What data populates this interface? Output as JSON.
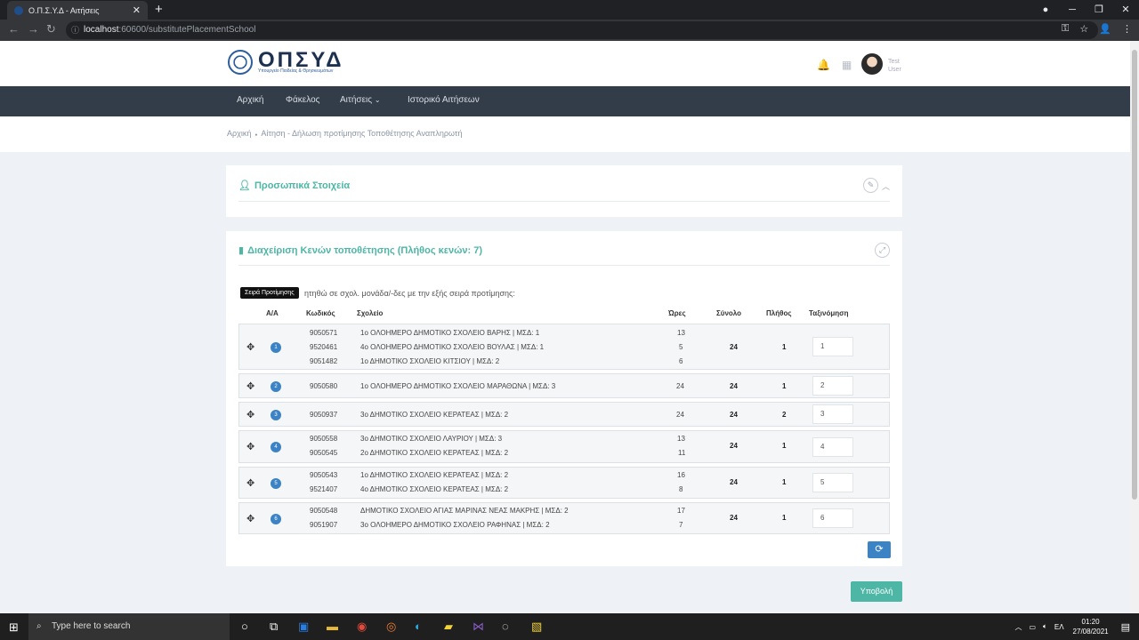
{
  "browser": {
    "tab_title": "Ο.Π.Σ.Υ.Δ - Αιτήσεις",
    "url_host": "localhost",
    "url_path": ":60600/substitutePlacementSchool"
  },
  "header": {
    "logo_title": "ΟΠΣΥΔ",
    "logo_subtitle": "Υπουργείο Παιδείας & Θρησκευμάτων",
    "user_line1": "Test",
    "user_line2": "User"
  },
  "nav": {
    "home": "Αρχική",
    "folder": "Φάκελος",
    "applications": "Αιτήσεις",
    "history": "Ιστορικό Αιτήσεων"
  },
  "breadcrumb": {
    "home": "Αρχική",
    "sep": "●",
    "current": "Αίτηση - Δήλωση προτίμησης Τοποθέτησης Αναπληρωτή"
  },
  "personal_panel": {
    "title": "Προσωπικά Στοιχεία"
  },
  "vacancies_panel": {
    "title": "Διαχείριση Κενών τοποθέτησης (Πλήθος κενών: 7)",
    "tooltip": "Σειρά Προτίμησης",
    "intro": "ητηθώ σε σχολ. μονάδα/-δες με την εξής σειρά προτίμησης:",
    "columns": {
      "aa": "Α/Α",
      "code": "Κωδικός",
      "school": "Σχολείο",
      "hours": "Ώρες",
      "total": "Σύνολο",
      "count": "Πλήθος",
      "ranking": "Ταξινόμηση"
    },
    "groups": [
      {
        "rank": "1",
        "total": "24",
        "count": "1",
        "order": "1",
        "rows": [
          {
            "code": "9050571",
            "school": "1ο ΟΛΟΗΜΕΡΟ ΔΗΜΟΤΙΚΟ ΣΧΟΛΕΙΟ ΒΑΡΗΣ | ΜΣΔ: 1",
            "hours": "13"
          },
          {
            "code": "9520461",
            "school": "4ο ΟΛΟΗΜΕΡΟ ΔΗΜΟΤΙΚΟ ΣΧΟΛΕΙΟ ΒΟΥΛΑΣ | ΜΣΔ: 1",
            "hours": "5"
          },
          {
            "code": "9051482",
            "school": "1ο ΔΗΜΟΤΙΚΟ ΣΧΟΛΕΙΟ ΚΙΤΣΙΟΥ | ΜΣΔ: 2",
            "hours": "6"
          }
        ]
      },
      {
        "rank": "2",
        "total": "24",
        "count": "1",
        "order": "2",
        "rows": [
          {
            "code": "9050580",
            "school": "1ο ΟΛΟΗΜΕΡΟ ΔΗΜΟΤΙΚΟ ΣΧΟΛΕΙΟ ΜΑΡΑΘΩΝΑ | ΜΣΔ: 3",
            "hours": "24"
          }
        ]
      },
      {
        "rank": "3",
        "total": "24",
        "count": "2",
        "order": "3",
        "rows": [
          {
            "code": "9050937",
            "school": "3ο ΔΗΜΟΤΙΚΟ ΣΧΟΛΕΙΟ ΚΕΡΑΤΕΑΣ | ΜΣΔ: 2",
            "hours": "24"
          }
        ]
      },
      {
        "rank": "4",
        "total": "24",
        "count": "1",
        "order": "4",
        "rows": [
          {
            "code": "9050558",
            "school": "3ο ΔΗΜΟΤΙΚΟ ΣΧΟΛΕΙΟ ΛΑΥΡΙΟΥ | ΜΣΔ: 3",
            "hours": "13"
          },
          {
            "code": "9050545",
            "school": "2ο ΔΗΜΟΤΙΚΟ ΣΧΟΛΕΙΟ ΚΕΡΑΤΕΑΣ | ΜΣΔ: 2",
            "hours": "11"
          }
        ]
      },
      {
        "rank": "5",
        "total": "24",
        "count": "1",
        "order": "5",
        "rows": [
          {
            "code": "9050543",
            "school": "1ο ΔΗΜΟΤΙΚΟ ΣΧΟΛΕΙΟ ΚΕΡΑΤΕΑΣ | ΜΣΔ: 2",
            "hours": "16"
          },
          {
            "code": "9521407",
            "school": "4ο ΔΗΜΟΤΙΚΟ ΣΧΟΛΕΙΟ ΚΕΡΑΤΕΑΣ | ΜΣΔ: 2",
            "hours": "8"
          }
        ]
      },
      {
        "rank": "6",
        "total": "24",
        "count": "1",
        "order": "6",
        "rows": [
          {
            "code": "9050548",
            "school": "ΔΗΜΟΤΙΚΟ ΣΧΟΛΕΙΟ ΑΓΙΑΣ ΜΑΡΙΝΑΣ ΝΕΑΣ ΜΑΚΡΗΣ | ΜΣΔ: 2",
            "hours": "17"
          },
          {
            "code": "9051907",
            "school": "3ο ΟΛΟΗΜΕΡΟ ΔΗΜΟΤΙΚΟ ΣΧΟΛΕΙΟ ΡΑΦΗΝΑΣ | ΜΣΔ: 2",
            "hours": "7"
          }
        ]
      }
    ]
  },
  "actions": {
    "submit": "Υποβολή"
  },
  "taskbar": {
    "search_placeholder": "Type here to search",
    "lang": "ΕΛ",
    "time": "01:20",
    "date": "27/08/2021"
  },
  "colors": {
    "accent_teal": "#4db6a5",
    "badge_blue": "#3b83c4",
    "nav_dark": "#333d49"
  }
}
